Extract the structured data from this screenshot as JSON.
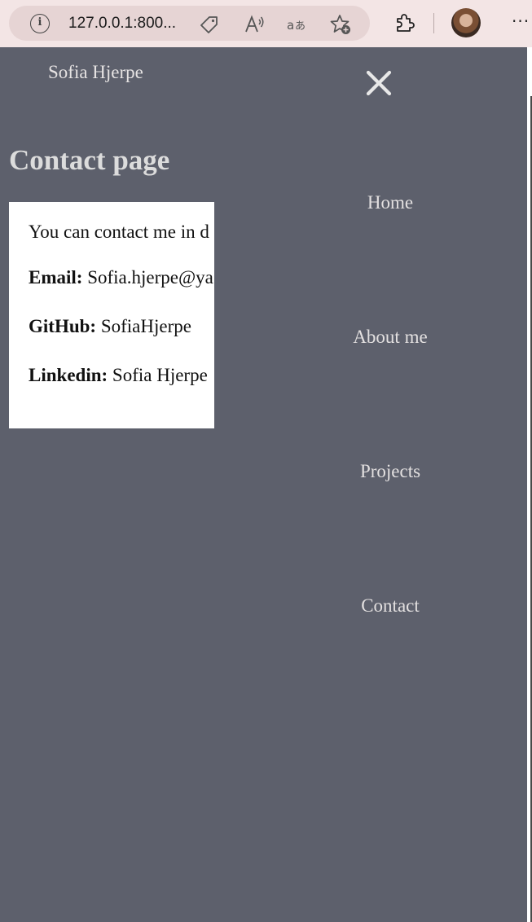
{
  "browser": {
    "url": "127.0.0.1:800...",
    "icons": [
      "info-icon",
      "tag-icon",
      "read-aloud-icon",
      "translate-icon",
      "favorite-add-icon",
      "extensions-icon",
      "profile-avatar",
      "more-icon"
    ],
    "more_label": "···"
  },
  "header": {
    "site_name": "Sofia Hjerpe",
    "close_label": "×"
  },
  "main": {
    "title": "Contact page",
    "intro": "You can contact me in d",
    "email_label": "Email:",
    "email_value": "Sofia.hjerpe@ya",
    "github_label": "GitHub:",
    "github_value": "SofiaHjerpe",
    "linkedin_label": "Linkedin:",
    "linkedin_value": "Sofia Hjerpe"
  },
  "nav": {
    "items": [
      {
        "label": "Home"
      },
      {
        "label": "About me"
      },
      {
        "label": "Projects"
      },
      {
        "label": "Contact"
      }
    ]
  },
  "colors": {
    "page_bg": "#5d606c",
    "chrome_bg": "#f3e5e5",
    "card_bg": "#ffffff",
    "nav_text": "#e3e0e0"
  }
}
